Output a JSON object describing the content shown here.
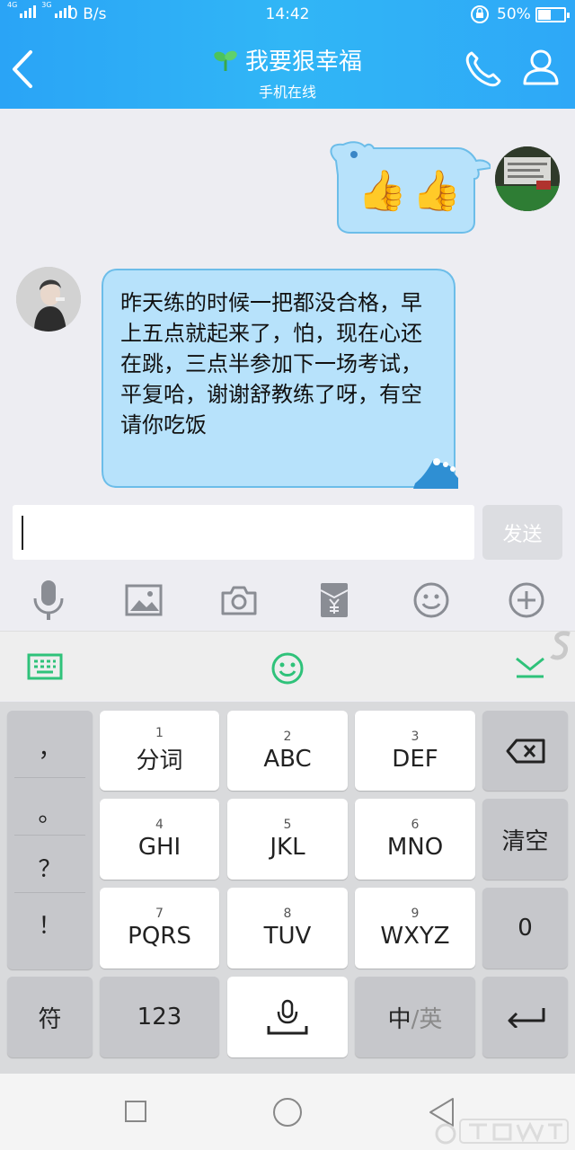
{
  "status_bar": {
    "signal_labels": [
      "4G",
      "3G"
    ],
    "net_speed": "0 B/s",
    "time": "14:42",
    "battery_percent": "50%",
    "battery_level": 0.5
  },
  "header": {
    "contact_name": "我要狠幸福",
    "status": "手机在线",
    "icons": [
      "back-arrow-icon",
      "sprout-icon",
      "phone-icon",
      "person-icon"
    ]
  },
  "messages": [
    {
      "direction": "outgoing",
      "content": "👍👍"
    },
    {
      "direction": "incoming",
      "content": "昨天练的时候一把都没合格，早上五点就起来了，怕，现在心还在跳，三点半参加下一场考试，平复哈，谢谢舒教练了呀，有空请你吃饭"
    }
  ],
  "composer": {
    "input_value": "",
    "send_label": "发送",
    "tools": [
      "microphone-icon",
      "image-icon",
      "camera-icon",
      "red-packet-icon",
      "emoji-icon",
      "plus-icon"
    ]
  },
  "keyboard": {
    "toolbar_icons": [
      "keyboard-icon",
      "emoji-icon",
      "collapse-icon"
    ],
    "punctuation": [
      "，",
      "。",
      "？",
      "！"
    ],
    "keys": [
      {
        "num": "1",
        "label": "分词"
      },
      {
        "num": "2",
        "label": "ABC"
      },
      {
        "num": "3",
        "label": "DEF"
      },
      {
        "num": "4",
        "label": "GHI"
      },
      {
        "num": "5",
        "label": "JKL"
      },
      {
        "num": "6",
        "label": "MNO"
      },
      {
        "num": "7",
        "label": "PQRS"
      },
      {
        "num": "8",
        "label": "TUV"
      },
      {
        "num": "9",
        "label": "WXYZ"
      }
    ],
    "clear_label": "清空",
    "zero_label": "0",
    "symbol_label": "符",
    "num_label": "123",
    "lang_label_cn": "中",
    "lang_label_sep": "/",
    "lang_label_en": "英"
  },
  "colors": {
    "header": "#2eaef6",
    "bubble": "#b7e2fb",
    "bubble_border": "#6cbde9",
    "accent_green": "#2fc27a"
  }
}
